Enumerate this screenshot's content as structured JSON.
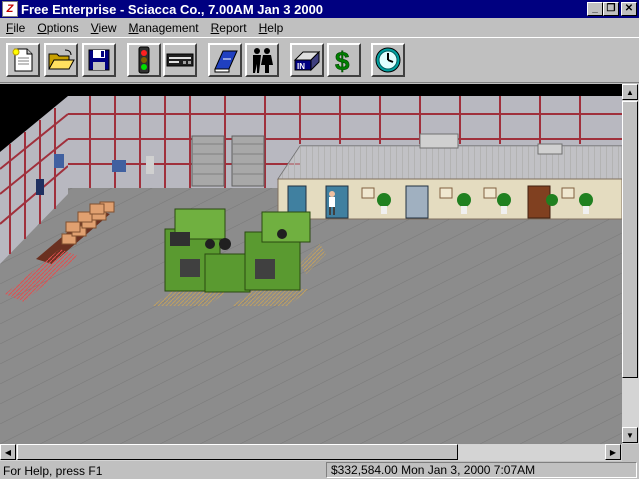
{
  "window": {
    "title": "Free Enterprise - Sciacca Co.,  7.00AM Jan 3 2000",
    "buttons": {
      "minimize": "_",
      "restore": "❐",
      "close": "✕"
    }
  },
  "menu": {
    "items": [
      {
        "label": "File",
        "hotkey": "F",
        "rest": "ile"
      },
      {
        "label": "Options",
        "hotkey": "O",
        "rest": "ptions"
      },
      {
        "label": "View",
        "hotkey": "V",
        "rest": "iew"
      },
      {
        "label": "Management",
        "hotkey": "M",
        "rest": "anagement"
      },
      {
        "label": "Report",
        "hotkey": "R",
        "rest": "eport"
      },
      {
        "label": "Help",
        "hotkey": "H",
        "rest": "elp"
      }
    ]
  },
  "toolbar": {
    "buttons": [
      {
        "icon": "new-document-icon"
      },
      {
        "icon": "open-folder-icon"
      },
      {
        "icon": "save-disk-icon"
      },
      {
        "icon": "traffic-light-icon"
      },
      {
        "icon": "machine-icon"
      },
      {
        "icon": "book-icon"
      },
      {
        "icon": "people-icon"
      },
      {
        "icon": "in-tray-icon",
        "text": "IN"
      },
      {
        "icon": "dollar-icon",
        "text": "$"
      },
      {
        "icon": "clock-icon"
      }
    ]
  },
  "status": {
    "help": "For Help, press F1",
    "money_time": "$332,584.00  Mon Jan 3, 2000  7:07AM"
  },
  "colors": {
    "title_bar": "#000080",
    "floor": "#8c8c8c",
    "wall_frame": "#a0303c",
    "machine": "#5a9a30"
  }
}
